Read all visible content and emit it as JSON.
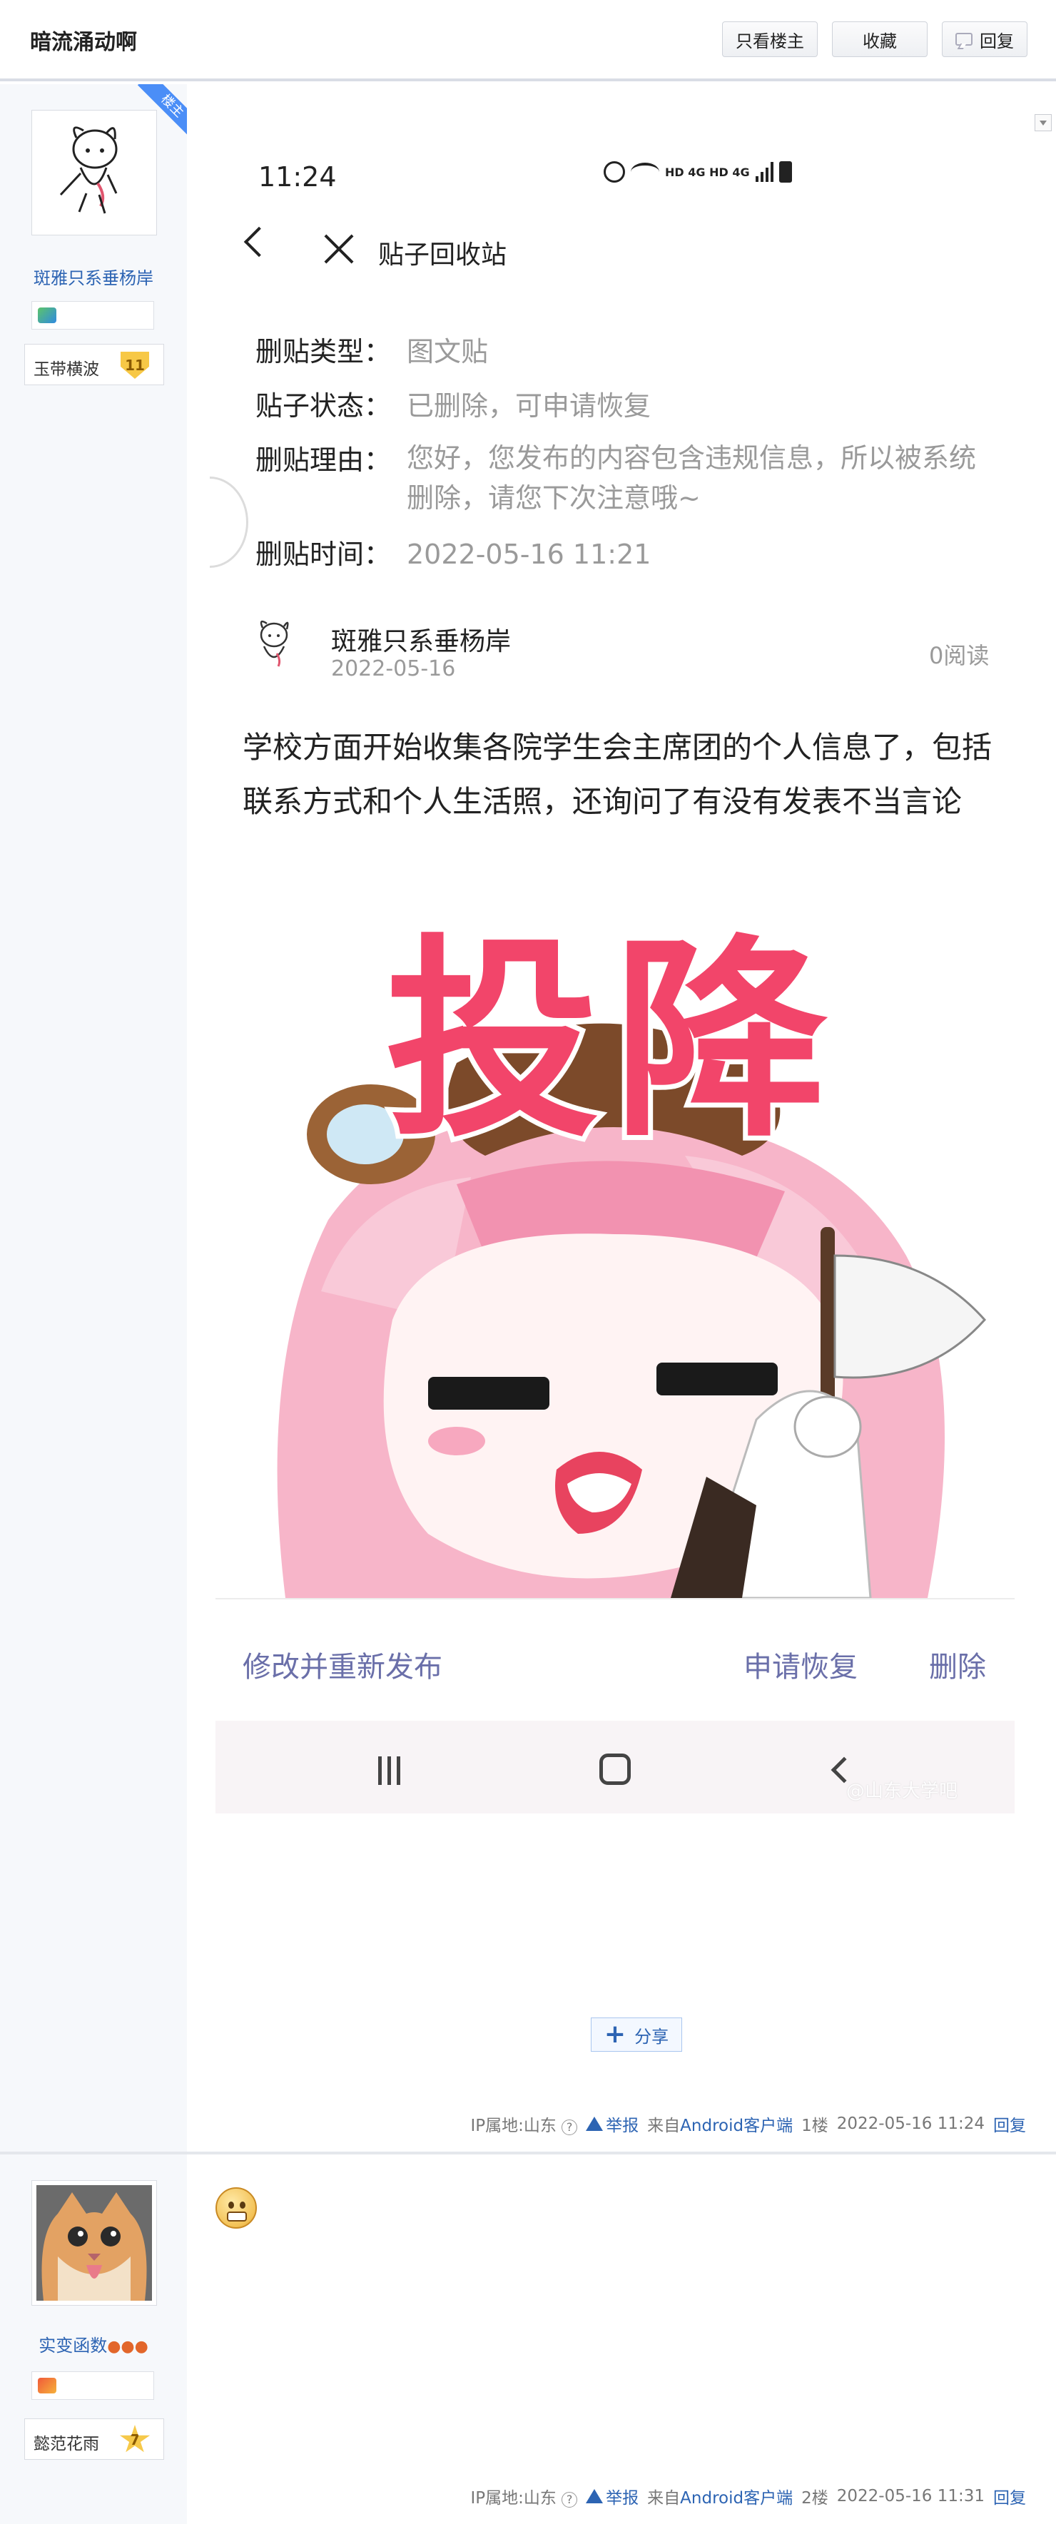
{
  "header": {
    "title": "暗流涌动啊",
    "btn_author_only": "只看楼主",
    "btn_collect": "收藏",
    "btn_reply": "回复"
  },
  "post1": {
    "ribbon": "楼主",
    "username": "斑雅只系垂杨岸",
    "level_name": "玉带横波",
    "level_num": "11",
    "screenshot": {
      "time": "11:24",
      "status_text": "HD 4G HD 4G",
      "nav_title": "贴子回收站",
      "fields": [
        {
          "key": "删贴类型：",
          "value": "图文贴"
        },
        {
          "key": "贴子状态：",
          "value": "已删除，可申请恢复"
        },
        {
          "key": "删贴理由：",
          "value": "您好，您发布的内容包含违规信息，所以被系统删除，请您下次注意哦~"
        },
        {
          "key": "删贴时间：",
          "value": "2022-05-16 11:21"
        }
      ],
      "author_name": "斑雅只系垂杨岸",
      "author_date": "2022-05-16",
      "read_count": "0阅读",
      "body": "学校方面开始收集各院学生会主席团的个人信息了，包括联系方式和个人生活照，还询问了有没有发表不当言论",
      "sticker_text": "投降",
      "actions": {
        "edit": "修改并重新发布",
        "restore": "申请恢复",
        "delete": "删除"
      },
      "watermark": "@山东大学吧"
    },
    "share": "分享",
    "meta": {
      "ip": "IP属地:山东",
      "report": "举报",
      "source_prefix": "来自",
      "source": "Android客户端",
      "floor": "1楼",
      "time": "2022-05-16 11:24",
      "reply": "回复"
    }
  },
  "post2": {
    "username": "实变函数",
    "level_name": "懿范花雨",
    "level_num": "7",
    "meta": {
      "ip": "IP属地:山东",
      "report": "举报",
      "source_prefix": "来自",
      "source": "Android客户端",
      "floor": "2楼",
      "time": "2022-05-16 11:31",
      "reply": "回复"
    }
  },
  "colors": {
    "link": "#2d64b3",
    "action": "#6a6fa9",
    "sticker_text": "#f2456a",
    "ribbon": "#4b8ef7"
  }
}
